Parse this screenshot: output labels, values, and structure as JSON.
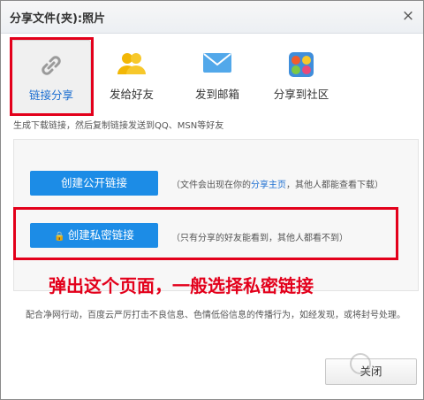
{
  "dialog": {
    "title": "分享文件(夹):照片",
    "close_glyph": "×"
  },
  "tabs": [
    {
      "label": "链接分享",
      "icon": "link-icon",
      "active": true
    },
    {
      "label": "发给好友",
      "icon": "friends-icon",
      "active": false
    },
    {
      "label": "发到邮箱",
      "icon": "mail-icon",
      "active": false
    },
    {
      "label": "分享到社区",
      "icon": "community-icon",
      "active": false
    }
  ],
  "description": "生成下载链接，然后复制链接发送到QQ、MSN等好友",
  "public_link": {
    "button_label": "创建公开链接",
    "note_before": "（文件会出现在你的",
    "note_link": "分享主页",
    "note_after": "，其他人都能查看下载）"
  },
  "private_link": {
    "lock_glyph": "🔒",
    "button_label": "创建私密链接",
    "note": "（只有分享的好友能看到，其他人都看不到）"
  },
  "annotation": "弹出这个页面，一般选择私密链接",
  "footer_text": "配合净网行动，百度云严厉打击不良信息、色情低俗信息的传播行为，如经发现，或将封号处理。",
  "close_button_label": "关闭",
  "colors": {
    "accent": "#1c8ce6",
    "highlight": "#e3001b",
    "link": "#1d6fd1"
  }
}
